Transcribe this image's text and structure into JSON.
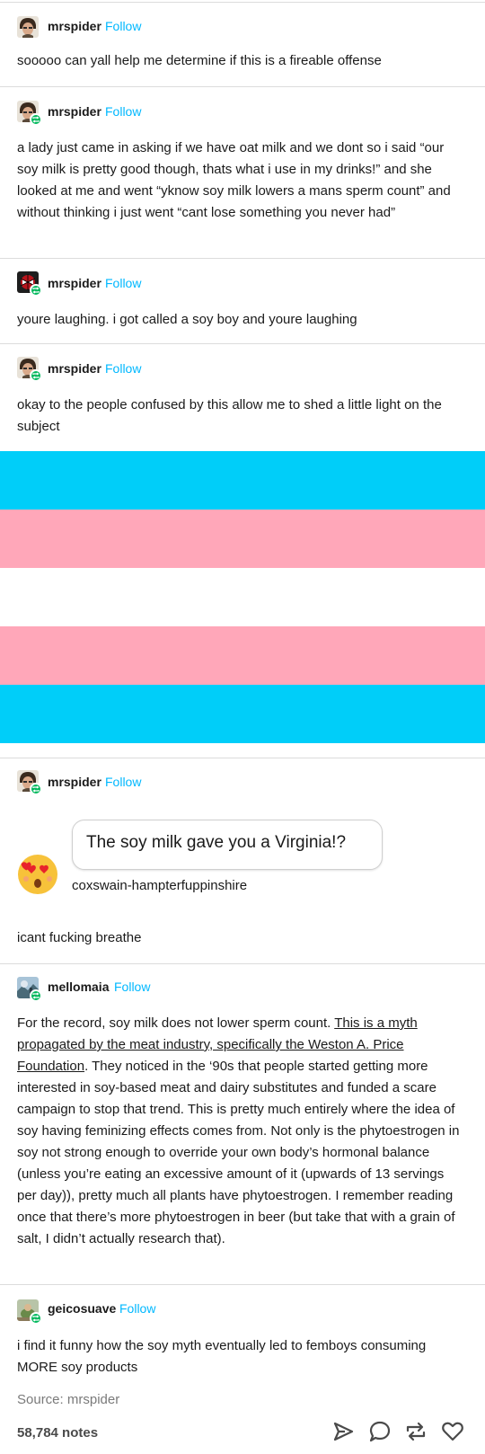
{
  "posts": [
    {
      "username": "mrspider",
      "follow_label": "Follow",
      "body": "sooooo can yall help me determine if this is a fireable offense"
    },
    {
      "username": "mrspider",
      "follow_label": "Follow",
      "body": "a lady just came in asking if we have oat milk and we dont so i said “our soy milk is pretty good though, thats what i use in my drinks!” and she looked at me and went “yknow soy milk lowers a mans sperm count” and without thinking i just went “cant lose something you never had”"
    },
    {
      "username": "mrspider",
      "follow_label": "Follow",
      "body": "youre laughing. i got called a soy boy and youre laughing"
    },
    {
      "username": "mrspider",
      "follow_label": "Follow",
      "body": "okay to the people confused by this allow me to shed a little light on the subject"
    },
    {
      "username": "mrspider",
      "follow_label": "Follow",
      "ask_text": "The soy milk gave you a Virginia!?",
      "ask_name": "coxswain-hampterfuppinshire",
      "body": "icant fucking breathe"
    },
    {
      "username": "mellomaia",
      "follow_label": "Follow",
      "body_start": "For the record, soy milk does not lower sperm count. ",
      "body_link": "This is a myth propagated by the meat industry, specifically the Weston A. Price Foundation",
      "body_rest": ". They noticed in the ‘90s that people started getting more interested in soy-based meat and dairy substitutes and funded a scare campaign to stop that trend. This is pretty much entirely where the idea of soy having feminizing effects comes from. Not only is the phytoestrogen in soy not strong enough to override your own body’s hormonal balance (unless you’re eating an excessive amount of it (upwards of 13 servings per day)), pretty much all plants have phytoestrogen. I remember reading once that there’s more phytoestrogen in beer (but take that with a grain of salt, I didn’t actually research that)."
    },
    {
      "username": "geicosuave",
      "follow_label": "Follow",
      "body": "i find it funny how the soy myth eventually led to femboys consuming MORE soy products"
    }
  ],
  "footer": {
    "source": "Source: mrspider",
    "notes": "58,784 notes"
  },
  "icons": [
    "share-icon",
    "reply-icon",
    "reblog-icon",
    "like-icon"
  ],
  "colors": {
    "follow": "#00b8ff",
    "flag_blue": "#00cef9",
    "flag_pink": "#ffa7b9",
    "flag_white": "#ffffff",
    "reblog_badge": "#00b85c"
  }
}
